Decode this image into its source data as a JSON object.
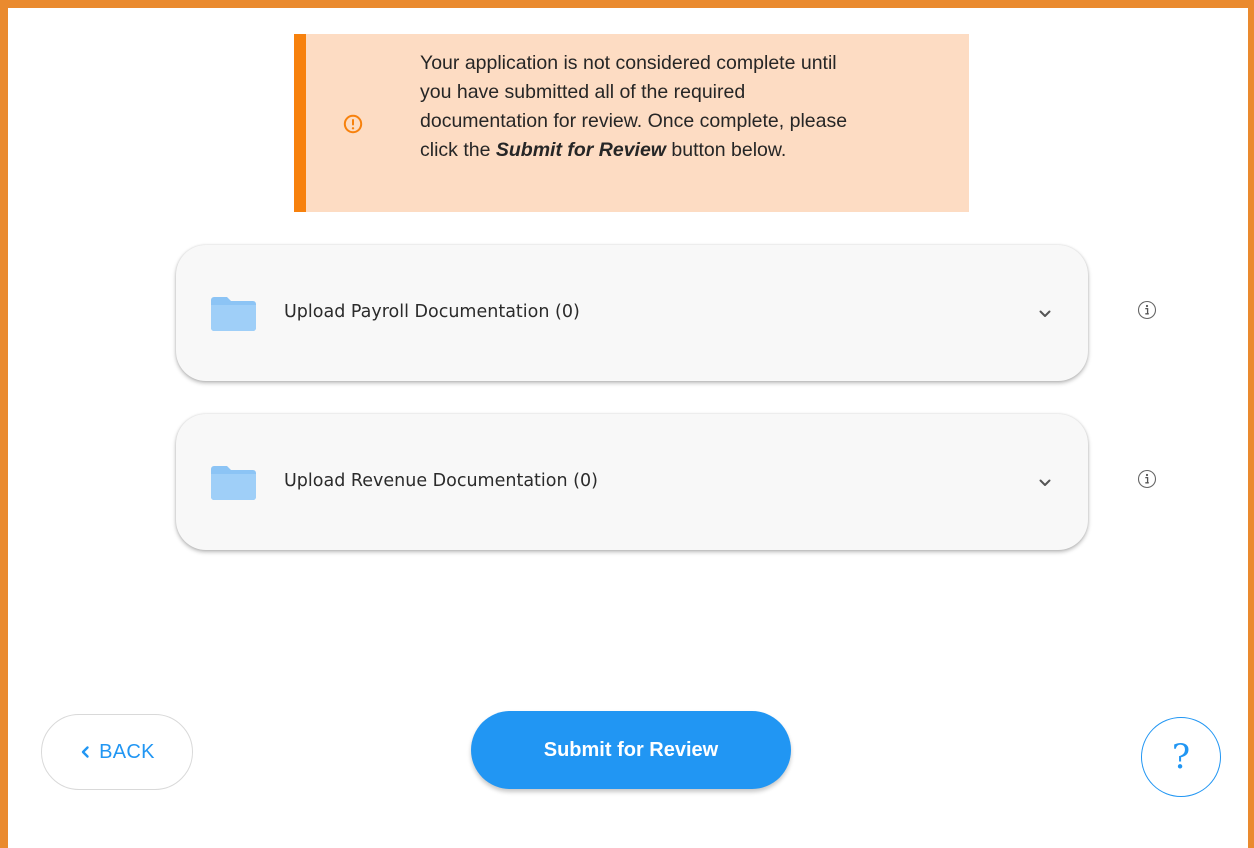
{
  "notice": {
    "line1": "Your application is not considered complete until",
    "line2": "you have submitted all of the required",
    "line3": "documentation for review. Once complete, please",
    "line4_prefix": "click the ",
    "line4_emphasis": "Submit for Review",
    "line4_suffix": " button below.",
    "icon": "alert-circle-icon",
    "accent_color": "#f7810d",
    "background_color": "#fddcc3"
  },
  "upload_sections": [
    {
      "label": "Upload Payroll Documentation (0)",
      "icon": "folder-icon",
      "info_icon": "info-icon"
    },
    {
      "label": "Upload Revenue Documentation (0)",
      "icon": "folder-icon",
      "info_icon": "info-icon"
    }
  ],
  "footer": {
    "back_label": "BACK",
    "submit_label": "Submit for Review",
    "help_label": "?"
  },
  "colors": {
    "frame_border": "#ea8a2e",
    "primary": "#2196f3",
    "folder": "#8cc4f5"
  }
}
